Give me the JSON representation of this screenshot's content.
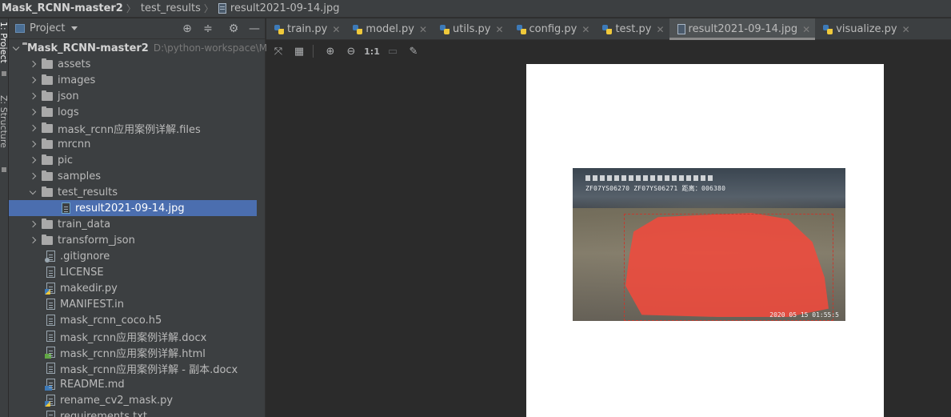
{
  "breadcrumb": {
    "project": "Mask_RCNN-master2",
    "folder": "test_results",
    "file": "result2021-09-14.jpg"
  },
  "toolstrip": {
    "project_tab": "1: Project",
    "structure_tab": "Z: Structure"
  },
  "project_panel": {
    "title": "Project",
    "root_label": "Mask_RCNN-master2",
    "root_path": "D:\\python-workspace\\Ma",
    "items": [
      {
        "label": "assets"
      },
      {
        "label": "images"
      },
      {
        "label": "json"
      },
      {
        "label": "logs"
      },
      {
        "label": "mask_rcnn应用案例详解.files"
      },
      {
        "label": "mrcnn"
      },
      {
        "label": "pic"
      },
      {
        "label": "samples"
      },
      {
        "label": "test_results"
      },
      {
        "label": "result2021-09-14.jpg"
      },
      {
        "label": "train_data"
      },
      {
        "label": "transform_json"
      },
      {
        "label": ".gitignore"
      },
      {
        "label": "LICENSE"
      },
      {
        "label": "makedir.py"
      },
      {
        "label": "MANIFEST.in"
      },
      {
        "label": "mask_rcnn_coco.h5"
      },
      {
        "label": "mask_rcnn应用案例详解.docx"
      },
      {
        "label": "mask_rcnn应用案例详解.html"
      },
      {
        "label": "mask_rcnn应用案例详解 - 副本.docx"
      },
      {
        "label": "README.md"
      },
      {
        "label": "rename_cv2_mask.py"
      },
      {
        "label": "requirements.txt"
      }
    ]
  },
  "tabs": [
    {
      "label": "train.py"
    },
    {
      "label": "model.py"
    },
    {
      "label": "utils.py"
    },
    {
      "label": "config.py"
    },
    {
      "label": "test.py"
    },
    {
      "label": "result2021-09-14.jpg"
    },
    {
      "label": "visualize.py"
    }
  ],
  "image_toolbar": {
    "actual_size": "1:1"
  },
  "photo": {
    "overlay_line1": "ZF07YS06270  ZF07YS06271  距离：006380",
    "timestamp": "2020 05 15  01:55:5"
  },
  "colors": {
    "selection": "#4b6eaf",
    "mask": "#f04a3c"
  }
}
